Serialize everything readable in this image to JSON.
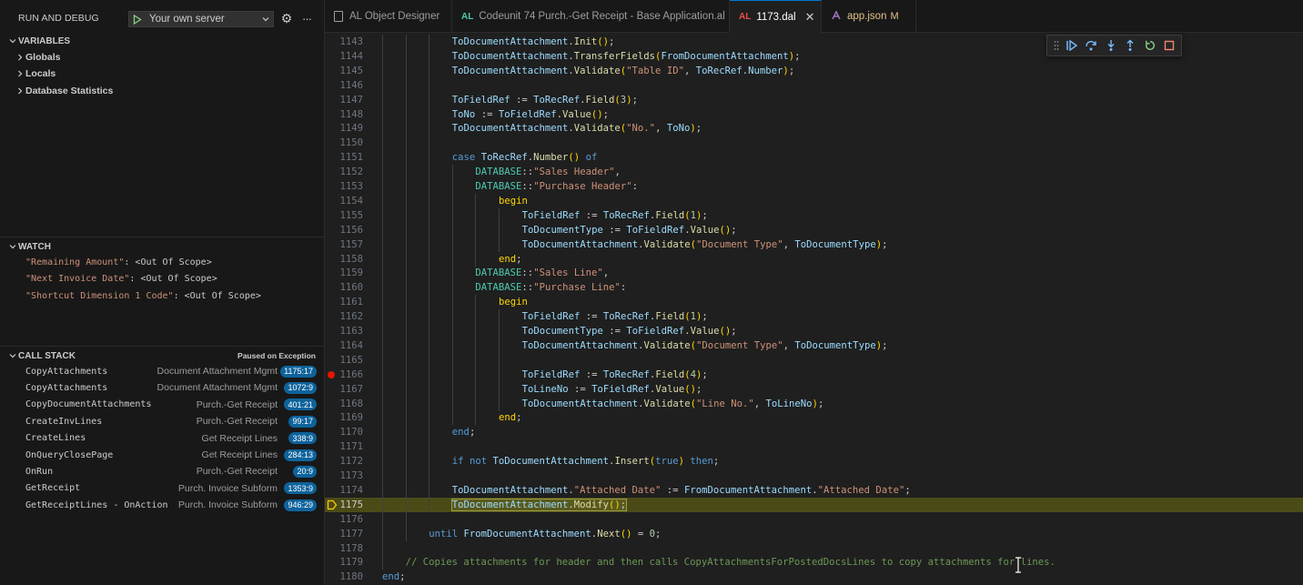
{
  "run_debug": {
    "title": "RUN AND DEBUG",
    "config": "Your own server"
  },
  "variables": {
    "title": "VARIABLES",
    "items": [
      "Globals",
      "Locals",
      "Database Statistics"
    ]
  },
  "watch": {
    "title": "WATCH",
    "items": [
      {
        "name": "\"Remaining Amount\"",
        "value": "<Out Of Scope>"
      },
      {
        "name": "\"Next Invoice Date\"",
        "value": "<Out Of Scope>"
      },
      {
        "name": "\"Shortcut Dimension 1 Code\"",
        "value": "<Out Of Scope>"
      }
    ]
  },
  "call_stack": {
    "title": "CALL STACK",
    "status": "Paused on Exception",
    "frames": [
      {
        "name": "CopyAttachments",
        "source": "Document Attachment Mgmt",
        "pos": "1175:17"
      },
      {
        "name": "CopyAttachments",
        "source": "Document Attachment Mgmt",
        "pos": "1072:9"
      },
      {
        "name": "CopyDocumentAttachments",
        "source": "Purch.-Get Receipt",
        "pos": "401:21"
      },
      {
        "name": "CreateInvLines",
        "source": "Purch.-Get Receipt",
        "pos": "99:17"
      },
      {
        "name": "CreateLines",
        "source": "Get Receipt Lines",
        "pos": "338:9"
      },
      {
        "name": "OnQueryClosePage",
        "source": "Get Receipt Lines",
        "pos": "284:13"
      },
      {
        "name": "OnRun",
        "source": "Purch.-Get Receipt",
        "pos": "20:9"
      },
      {
        "name": "GetReceipt",
        "source": "Purch. Invoice Subform",
        "pos": "1353:9"
      },
      {
        "name": "GetReceiptLines - OnAction",
        "source": "Purch. Invoice Subform",
        "pos": "946:29"
      }
    ]
  },
  "tabs": [
    {
      "icon": "AL",
      "label": "AL Object Designer"
    },
    {
      "icon": "AL",
      "label": "Codeunit 74 Purch.-Get Receipt - Base Application.al"
    },
    {
      "icon": "AL",
      "label": "1173.dal",
      "close": "✕"
    },
    {
      "icon": "{}",
      "label": "app.json",
      "modified": "M"
    }
  ],
  "editor": {
    "current_line": 1175,
    "breakpoint_line": 1166,
    "lines": [
      {
        "n": 1143,
        "indent": 3,
        "t": [
          [
            "ToDocumentAttachment",
            "var"
          ],
          [
            ".",
            ""
          ],
          [
            "Init",
            "fn"
          ],
          [
            "()",
            "brace"
          ],
          [
            ";",
            ""
          ]
        ]
      },
      {
        "n": 1144,
        "indent": 3,
        "t": [
          [
            "ToDocumentAttachment",
            "var"
          ],
          [
            ".",
            ""
          ],
          [
            "TransferFields",
            "fn"
          ],
          [
            "(",
            "brace"
          ],
          [
            "FromDocumentAttachment",
            "var"
          ],
          [
            ")",
            "brace"
          ],
          [
            ";",
            ""
          ]
        ]
      },
      {
        "n": 1145,
        "indent": 3,
        "t": [
          [
            "ToDocumentAttachment",
            "var"
          ],
          [
            ".",
            ""
          ],
          [
            "Validate",
            "fn"
          ],
          [
            "(",
            "brace"
          ],
          [
            "\"Table ID\"",
            "str"
          ],
          [
            ", ",
            ""
          ],
          [
            "ToRecRef",
            "var"
          ],
          [
            ".",
            ""
          ],
          [
            "Number",
            "var"
          ],
          [
            ")",
            "brace"
          ],
          [
            ";",
            ""
          ]
        ]
      },
      {
        "n": 1146,
        "indent": 3,
        "t": []
      },
      {
        "n": 1147,
        "indent": 3,
        "t": [
          [
            "ToFieldRef",
            "var"
          ],
          [
            " := ",
            ""
          ],
          [
            "ToRecRef",
            "var"
          ],
          [
            ".",
            ""
          ],
          [
            "Field",
            "fn"
          ],
          [
            "(",
            "brace"
          ],
          [
            "3",
            "num"
          ],
          [
            ")",
            "brace"
          ],
          [
            ";",
            ""
          ]
        ]
      },
      {
        "n": 1148,
        "indent": 3,
        "t": [
          [
            "ToNo",
            "var"
          ],
          [
            " := ",
            ""
          ],
          [
            "ToFieldRef",
            "var"
          ],
          [
            ".",
            ""
          ],
          [
            "Value",
            "fn"
          ],
          [
            "()",
            "brace"
          ],
          [
            ";",
            ""
          ]
        ]
      },
      {
        "n": 1149,
        "indent": 3,
        "t": [
          [
            "ToDocumentAttachment",
            "var"
          ],
          [
            ".",
            ""
          ],
          [
            "Validate",
            "fn"
          ],
          [
            "(",
            "brace"
          ],
          [
            "\"No.\"",
            "str"
          ],
          [
            ", ",
            ""
          ],
          [
            "ToNo",
            "var"
          ],
          [
            ")",
            "brace"
          ],
          [
            ";",
            ""
          ]
        ]
      },
      {
        "n": 1150,
        "indent": 3,
        "t": []
      },
      {
        "n": 1151,
        "indent": 3,
        "t": [
          [
            "case",
            "kw"
          ],
          [
            " ",
            ""
          ],
          [
            "ToRecRef",
            "var"
          ],
          [
            ".",
            ""
          ],
          [
            "Number",
            "fn"
          ],
          [
            "()",
            "brace"
          ],
          [
            " ",
            ""
          ],
          [
            "of",
            "kw"
          ]
        ]
      },
      {
        "n": 1152,
        "indent": 4,
        "t": [
          [
            "DATABASE",
            "type"
          ],
          [
            "::",
            ""
          ],
          [
            "\"Sales Header\"",
            "str"
          ],
          [
            ",",
            ""
          ]
        ]
      },
      {
        "n": 1153,
        "indent": 4,
        "t": [
          [
            "DATABASE",
            "type"
          ],
          [
            "::",
            ""
          ],
          [
            "\"Purchase Header\"",
            "str"
          ],
          [
            ":",
            ""
          ]
        ]
      },
      {
        "n": 1154,
        "indent": 5,
        "t": [
          [
            "begin",
            "brace"
          ]
        ]
      },
      {
        "n": 1155,
        "indent": 6,
        "t": [
          [
            "ToFieldRef",
            "var"
          ],
          [
            " := ",
            ""
          ],
          [
            "ToRecRef",
            "var"
          ],
          [
            ".",
            ""
          ],
          [
            "Field",
            "fn"
          ],
          [
            "(",
            "brace"
          ],
          [
            "1",
            "num"
          ],
          [
            ")",
            "brace"
          ],
          [
            ";",
            ""
          ]
        ]
      },
      {
        "n": 1156,
        "indent": 6,
        "t": [
          [
            "ToDocumentType",
            "var"
          ],
          [
            " := ",
            ""
          ],
          [
            "ToFieldRef",
            "var"
          ],
          [
            ".",
            ""
          ],
          [
            "Value",
            "fn"
          ],
          [
            "()",
            "brace"
          ],
          [
            ";",
            ""
          ]
        ]
      },
      {
        "n": 1157,
        "indent": 6,
        "t": [
          [
            "ToDocumentAttachment",
            "var"
          ],
          [
            ".",
            ""
          ],
          [
            "Validate",
            "fn"
          ],
          [
            "(",
            "brace"
          ],
          [
            "\"Document Type\"",
            "str"
          ],
          [
            ", ",
            ""
          ],
          [
            "ToDocumentType",
            "var"
          ],
          [
            ")",
            "brace"
          ],
          [
            ";",
            ""
          ]
        ]
      },
      {
        "n": 1158,
        "indent": 5,
        "t": [
          [
            "end",
            "brace"
          ],
          [
            ";",
            ""
          ]
        ]
      },
      {
        "n": 1159,
        "indent": 4,
        "t": [
          [
            "DATABASE",
            "type"
          ],
          [
            "::",
            ""
          ],
          [
            "\"Sales Line\"",
            "str"
          ],
          [
            ",",
            ""
          ]
        ]
      },
      {
        "n": 1160,
        "indent": 4,
        "t": [
          [
            "DATABASE",
            "type"
          ],
          [
            "::",
            ""
          ],
          [
            "\"Purchase Line\"",
            "str"
          ],
          [
            ":",
            ""
          ]
        ]
      },
      {
        "n": 1161,
        "indent": 5,
        "t": [
          [
            "begin",
            "brace"
          ]
        ]
      },
      {
        "n": 1162,
        "indent": 6,
        "t": [
          [
            "ToFieldRef",
            "var"
          ],
          [
            " := ",
            ""
          ],
          [
            "ToRecRef",
            "var"
          ],
          [
            ".",
            ""
          ],
          [
            "Field",
            "fn"
          ],
          [
            "(",
            "brace"
          ],
          [
            "1",
            "num"
          ],
          [
            ")",
            "brace"
          ],
          [
            ";",
            ""
          ]
        ]
      },
      {
        "n": 1163,
        "indent": 6,
        "t": [
          [
            "ToDocumentType",
            "var"
          ],
          [
            " := ",
            ""
          ],
          [
            "ToFieldRef",
            "var"
          ],
          [
            ".",
            ""
          ],
          [
            "Value",
            "fn"
          ],
          [
            "()",
            "brace"
          ],
          [
            ";",
            ""
          ]
        ]
      },
      {
        "n": 1164,
        "indent": 6,
        "t": [
          [
            "ToDocumentAttachment",
            "var"
          ],
          [
            ".",
            ""
          ],
          [
            "Validate",
            "fn"
          ],
          [
            "(",
            "brace"
          ],
          [
            "\"Document Type\"",
            "str"
          ],
          [
            ", ",
            ""
          ],
          [
            "ToDocumentType",
            "var"
          ],
          [
            ")",
            "brace"
          ],
          [
            ";",
            ""
          ]
        ]
      },
      {
        "n": 1165,
        "indent": 6,
        "t": []
      },
      {
        "n": 1166,
        "indent": 6,
        "t": [
          [
            "ToFieldRef",
            "var"
          ],
          [
            " := ",
            ""
          ],
          [
            "ToRecRef",
            "var"
          ],
          [
            ".",
            ""
          ],
          [
            "Field",
            "fn"
          ],
          [
            "(",
            "brace"
          ],
          [
            "4",
            "num"
          ],
          [
            ")",
            "brace"
          ],
          [
            ";",
            ""
          ]
        ]
      },
      {
        "n": 1167,
        "indent": 6,
        "t": [
          [
            "ToLineNo",
            "var"
          ],
          [
            " := ",
            ""
          ],
          [
            "ToFieldRef",
            "var"
          ],
          [
            ".",
            ""
          ],
          [
            "Value",
            "fn"
          ],
          [
            "()",
            "brace"
          ],
          [
            ";",
            ""
          ]
        ]
      },
      {
        "n": 1168,
        "indent": 6,
        "t": [
          [
            "ToDocumentAttachment",
            "var"
          ],
          [
            ".",
            ""
          ],
          [
            "Validate",
            "fn"
          ],
          [
            "(",
            "brace"
          ],
          [
            "\"Line No.\"",
            "str"
          ],
          [
            ", ",
            ""
          ],
          [
            "ToLineNo",
            "var"
          ],
          [
            ")",
            "brace"
          ],
          [
            ";",
            ""
          ]
        ]
      },
      {
        "n": 1169,
        "indent": 5,
        "t": [
          [
            "end",
            "brace"
          ],
          [
            ";",
            ""
          ]
        ]
      },
      {
        "n": 1170,
        "indent": 3,
        "t": [
          [
            "end",
            "kw"
          ],
          [
            ";",
            ""
          ]
        ]
      },
      {
        "n": 1171,
        "indent": 3,
        "t": []
      },
      {
        "n": 1172,
        "indent": 3,
        "t": [
          [
            "if",
            "kw"
          ],
          [
            " ",
            ""
          ],
          [
            "not",
            "kw"
          ],
          [
            " ",
            ""
          ],
          [
            "ToDocumentAttachment",
            "var"
          ],
          [
            ".",
            ""
          ],
          [
            "Insert",
            "fn"
          ],
          [
            "(",
            "brace"
          ],
          [
            "true",
            "kw"
          ],
          [
            ")",
            "brace"
          ],
          [
            " ",
            ""
          ],
          [
            "then",
            "kw"
          ],
          [
            ";",
            ""
          ]
        ]
      },
      {
        "n": 1173,
        "indent": 3,
        "t": []
      },
      {
        "n": 1174,
        "indent": 3,
        "t": [
          [
            "ToDocumentAttachment",
            "var"
          ],
          [
            ".",
            ""
          ],
          [
            "\"Attached Date\"",
            "str"
          ],
          [
            " := ",
            ""
          ],
          [
            "FromDocumentAttachment",
            "var"
          ],
          [
            ".",
            ""
          ],
          [
            "\"Attached Date\"",
            "str"
          ],
          [
            ";",
            ""
          ]
        ]
      },
      {
        "n": 1175,
        "indent": 3,
        "t": [
          [
            "ToDocumentAttachment",
            "var"
          ],
          [
            ".",
            ""
          ],
          [
            "Modify",
            "fn"
          ],
          [
            "()",
            "brace"
          ],
          [
            ";",
            ""
          ]
        ]
      },
      {
        "n": 1176,
        "indent": 2,
        "t": []
      },
      {
        "n": 1177,
        "indent": 2,
        "t": [
          [
            "until",
            "kw"
          ],
          [
            " ",
            ""
          ],
          [
            "FromDocumentAttachment",
            "var"
          ],
          [
            ".",
            ""
          ],
          [
            "Next",
            "fn"
          ],
          [
            "()",
            "brace"
          ],
          [
            " = ",
            ""
          ],
          [
            "0",
            "num"
          ],
          [
            ";",
            ""
          ]
        ]
      },
      {
        "n": 1178,
        "indent": 1,
        "t": []
      },
      {
        "n": 1179,
        "indent": 1,
        "t": [
          [
            "// Copies attachments for header and then calls CopyAttachmentsForPostedDocsLines to copy attachments for lines.",
            "com"
          ]
        ]
      },
      {
        "n": 1180,
        "indent": 0,
        "t": [
          [
            "end",
            "kw"
          ],
          [
            ";",
            ""
          ]
        ]
      }
    ]
  },
  "debug_toolbar": [
    "grip-icon",
    "continue-icon",
    "step-over-icon",
    "step-into-icon",
    "step-out-icon",
    "restart-icon",
    "stop-icon"
  ]
}
